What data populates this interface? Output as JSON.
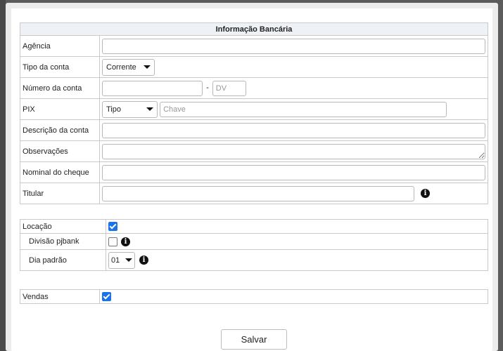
{
  "bank_info": {
    "header": "Informação Bancária",
    "agencia": {
      "label": "Agência",
      "value": ""
    },
    "tipo_conta": {
      "label": "Tipo da conta",
      "selected": "Corrente"
    },
    "numero_conta": {
      "label": "Número da conta",
      "value": "",
      "separator": "-",
      "dv_placeholder": "DV"
    },
    "pix": {
      "label": "PIX",
      "type_selected": "Tipo",
      "key_placeholder": "Chave"
    },
    "descricao": {
      "label": "Descrição da conta",
      "value": ""
    },
    "observacoes": {
      "label": "Observações",
      "value": ""
    },
    "nominal": {
      "label": "Nominal do cheque",
      "value": ""
    },
    "titular": {
      "label": "Titular",
      "value": ""
    }
  },
  "locacao": {
    "label": "Locação",
    "checked": true,
    "divisao": {
      "label": "Divisão pjbank",
      "checked": false
    },
    "dia_padrao": {
      "label": "Dia padrão",
      "selected": "01"
    }
  },
  "vendas": {
    "label": "Vendas",
    "checked": true
  },
  "footer": {
    "save_label": "Salvar"
  },
  "icons": {
    "info": "info-circle-icon",
    "caret": "caret-down-icon",
    "check": "checkbox-icon"
  },
  "colors": {
    "checkbox": "#1a73e8",
    "header_bg": "#eef2f6"
  }
}
